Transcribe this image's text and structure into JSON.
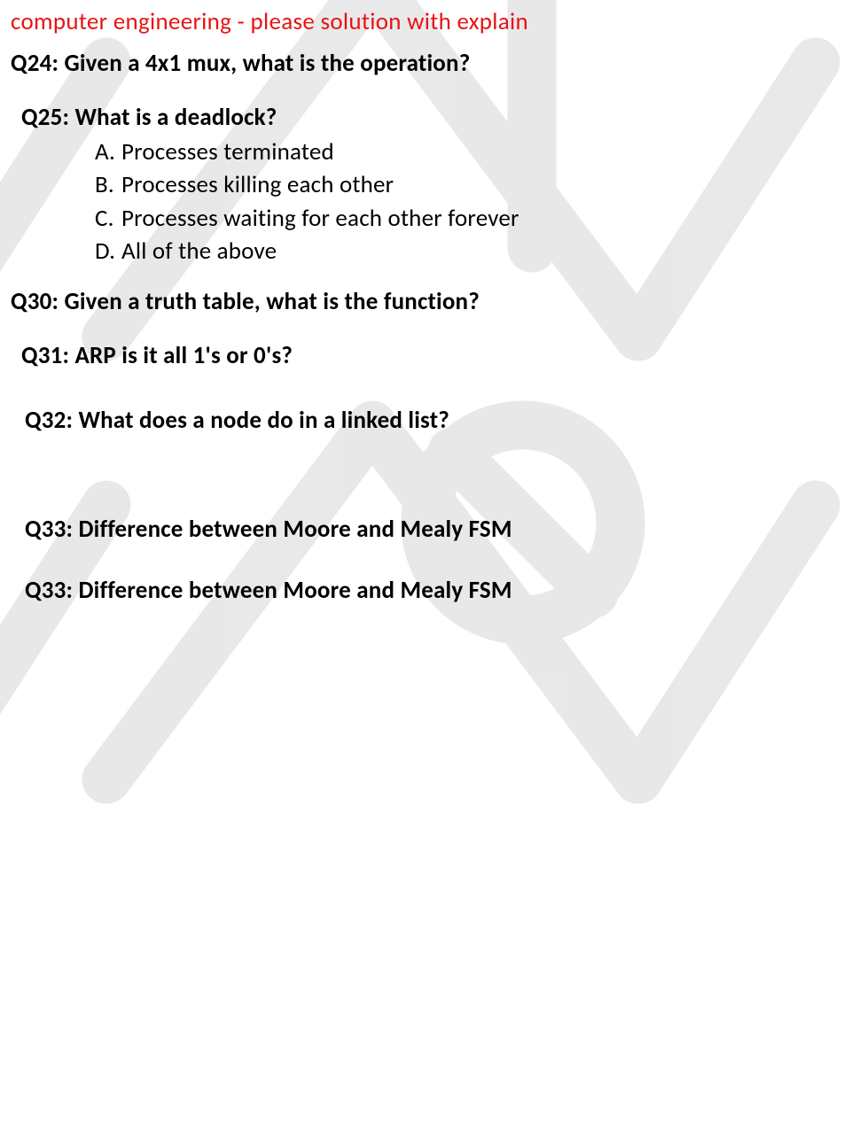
{
  "header": {
    "note": "computer engineering - please solution with explain"
  },
  "questions": {
    "q24": "Q24: Given a 4x1 mux, what is the operation?",
    "q25": {
      "text": "Q25: What is a deadlock?",
      "options": [
        {
          "letter": "A.",
          "text": "Processes terminated"
        },
        {
          "letter": "B.",
          "text": "Processes killing each other"
        },
        {
          "letter": "C.",
          "text": "Processes waiting for each other forever"
        },
        {
          "letter": "D.",
          "text": "All of the above"
        }
      ]
    },
    "q30": "Q30: Given a truth table, what is the function?",
    "q31": "Q31: ARP is it all 1's or 0's?",
    "q32": "Q32: What does a node do in a linked list?",
    "q33a": "Q33: Difference between Moore and Mealy FSM",
    "q33b": "Q33: Difference between Moore and Mealy FSM"
  }
}
